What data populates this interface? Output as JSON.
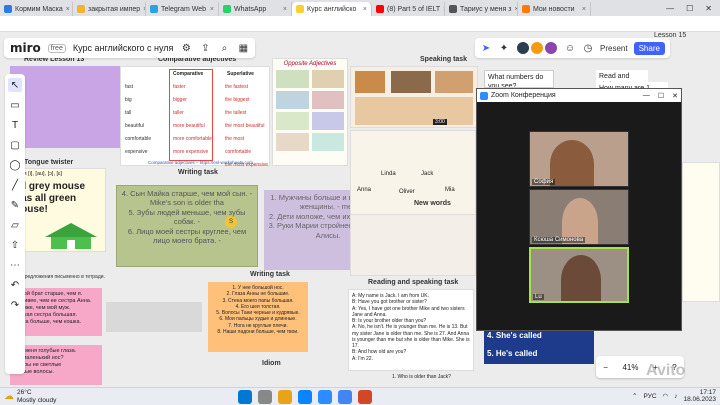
{
  "browser": {
    "tabs": [
      {
        "label": "Кормим Маска",
        "color": "#2a7be4"
      },
      {
        "label": "закрытая импер",
        "color": "#f2b233"
      },
      {
        "label": "Telegram Web",
        "color": "#2aa3e0"
      },
      {
        "label": "WhatsApp",
        "color": "#25d366"
      },
      {
        "label": "Курс английско",
        "color": "#ffd02f"
      },
      {
        "label": "(8) Part 5 of IELT",
        "color": "#ff0000"
      },
      {
        "label": "Тариус у меня з",
        "color": "#555555"
      },
      {
        "label": "Мои новости",
        "color": "#ff7b00"
      }
    ],
    "tab_close": "×",
    "win_min": "—",
    "win_max": "☐",
    "win_close": "✕"
  },
  "miro": {
    "logo": "miro",
    "plan": "free",
    "board_title": "Курс английского с нуля",
    "present_label": "Present",
    "share_label": "Share"
  },
  "board": {
    "review_title": "Review Lesson 13",
    "comparative_title": "Comparative adjectives",
    "opposite_title": "Opposite Adjectives",
    "speaking_title": "Speaking task",
    "writing_title": "Writing task",
    "new_words_title": "New words",
    "reading_title": "Reading and speaking task",
    "tongue_title": "Tongue twister",
    "idiom_title": "Idiom",
    "lesson_label": "Lesson 15",
    "comparative_table": [
      [
        "fast",
        "faster",
        "the fastest"
      ],
      [
        "big",
        "bigger",
        "the biggest"
      ],
      [
        "tall",
        "taller",
        "the tallest"
      ],
      [
        "beautiful",
        "more beautiful",
        "the most beautiful"
      ],
      [
        "comfortable",
        "more comfortable",
        "the most comfortable"
      ],
      [
        "expensive",
        "more expensive",
        "the most expensive"
      ]
    ],
    "comparative_head": [
      "Comparative",
      "Superlative"
    ],
    "tongue_sounds": "звуки [i], [au], [ɔ], [ɛ]",
    "tongue_text": "all grey mouse has all green house!",
    "translate_note": "предложения письменно в тетради.",
    "sticky_green_lines": [
      "4. Сын Майка старше, чем мой сын. - Mike's son is older tha",
      "5. Зубы людей меньше, чем зубы собак. -",
      "6. Лицо моей сестры круглее, чем лицо моего брата. -"
    ],
    "sticky_purple_lines": [
      "1. Мужчины больше и выше, чем женщины. - men",
      "2. Дети моложе, чем их родители.",
      "3. Руки Марии стройнее, чем руки Алисы."
    ],
    "orange_list": [
      "1. У нее большой нос.",
      "2. Глаза Анны не большие.",
      "3. Стена моего папы большая.",
      "4. Его шея толстая.",
      "5. Волосы Тани черные и кудрявые.",
      "6. Мои пальцы худые и длинные.",
      "7. Нога не круглые плечи.",
      "8. Наши ладони больше, чем твои."
    ],
    "pink_lines": [
      "1. Мой брат старше, чем я.",
      "красивее, чем ее сестра Анна.",
      "моложе, чем мой муж.",
      "Я такая сестра большая.",
      "кошка больше, чем кошка."
    ],
    "pink2_lines": [
      "1. У меня голубые глаза.",
      "его маленький нос?",
      "сестры не светлые",
      "черные волосы."
    ],
    "reading_text": "A: My name is Jack. I am from UK.\nB: Have you got brother or sister?\nA: Yes, I have got one brother Mike and two sisters Jane and Anna.\nB: Is your brother older than you?\nA: No, he isn't. He is younger than me. He is 13. But my sister Jane is older than me. She is 27. And Anna is younger than me but she is older than Mike. She is 17.\nB: And how old are you?\nA: I'm 22.",
    "question_small": "1. Who is older than Jack?",
    "what_numbers": "What numbers do you see?",
    "read_circle": "Read and circle.",
    "how_many": "How many are 1 really",
    "blue_a": "4. She's called",
    "blue_b": "5. He's called",
    "cartoon_names": [
      "Linda",
      "Jack",
      "Mia",
      "Anna",
      "Oliver"
    ],
    "mini_time": "3:00",
    "link_text": "Comparative adjectives – https://esl-worksheets.com",
    "lu_cursor": "Lu",
    "s_cursor": "S"
  },
  "zoom": {
    "title": "Zoom Конференция",
    "participants": [
      {
        "name": "София",
        "bg": "#b99f8c"
      },
      {
        "name": "Ксюша Симонова",
        "bg": "#8a7d74"
      },
      {
        "name": "Lu",
        "bg": "#9c8f83"
      }
    ],
    "active_border": "#a8e24a"
  },
  "zoom_controls": {
    "level": "41%",
    "minus": "−",
    "plus": "+",
    "help": "?"
  },
  "taskbar": {
    "temperature": "26°C",
    "weather": "Mostly cloudy",
    "language": "РУС",
    "time": "17:17",
    "date": "18.06.2023"
  },
  "watermark": "Avito"
}
